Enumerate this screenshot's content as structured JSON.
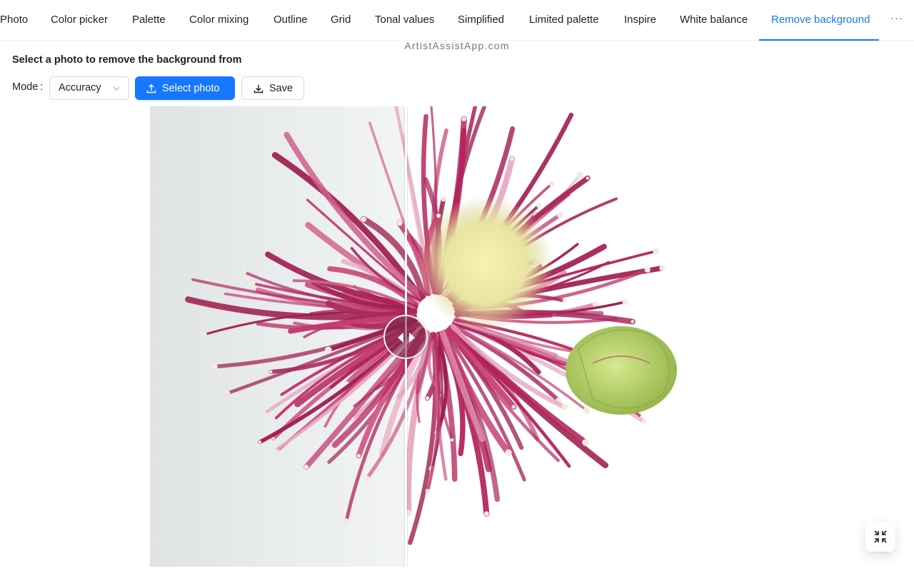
{
  "tabs": [
    {
      "label": "Photo",
      "active": false
    },
    {
      "label": "Color picker",
      "active": false
    },
    {
      "label": "Palette",
      "active": false
    },
    {
      "label": "Color mixing",
      "active": false
    },
    {
      "label": "Outline",
      "active": false
    },
    {
      "label": "Grid",
      "active": false
    },
    {
      "label": "Tonal values",
      "active": false
    },
    {
      "label": "Simplified",
      "active": false
    },
    {
      "label": "Limited palette",
      "active": false
    },
    {
      "label": "Inspire",
      "active": false
    },
    {
      "label": "White balance",
      "active": false
    },
    {
      "label": "Remove background",
      "active": true
    }
  ],
  "more_label": "···",
  "watermark": "ArtistAssistApp.com",
  "heading": "Select a photo to remove the background from",
  "mode": {
    "label": "Mode",
    "value": "Accuracy"
  },
  "buttons": {
    "select_photo": "Select photo",
    "save": "Save"
  },
  "icons": {
    "select": "upload-icon",
    "save": "download-icon",
    "mode_select": "chevron-down-icon",
    "compare_handle": "left-right-arrows-icon",
    "fullscreen": "fullscreen-exit-icon"
  },
  "colors": {
    "accent": "#1677ff",
    "flower_magenta": "#b3245c",
    "bud_green": "#b9d46a"
  }
}
